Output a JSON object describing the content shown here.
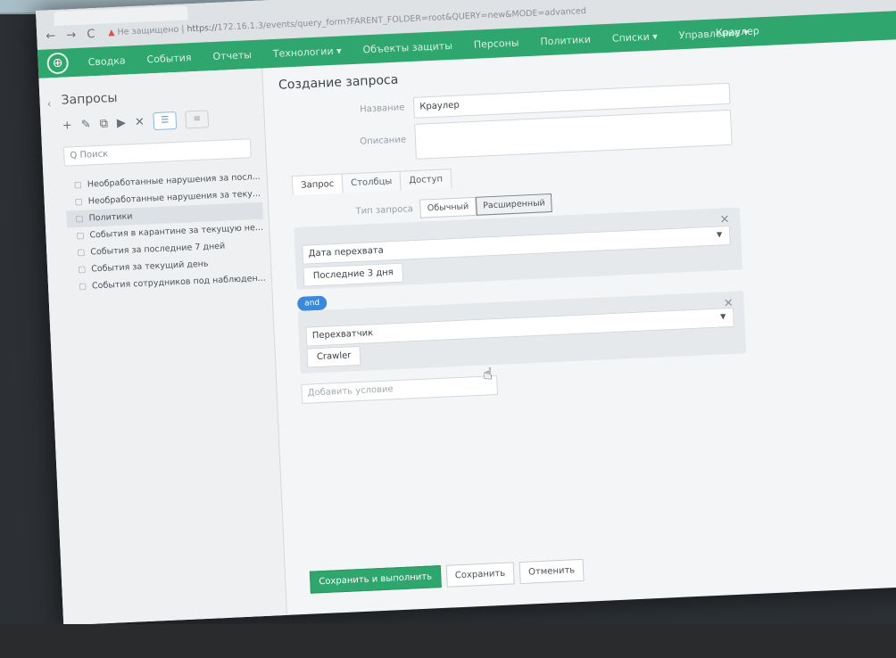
{
  "browser": {
    "tab_title": "",
    "back": "←",
    "forward": "→",
    "reload": "C",
    "warning_icon": "warning-icon",
    "security_label": "Не защищено",
    "url_proto": "https://",
    "url_rest": "172.16.1.3/events/query_form?FARENT_FOLDER=root&QUERY=new&MODE=advanced"
  },
  "appbar": {
    "nav": [
      "Сводка",
      "События",
      "Отчеты",
      "Технологии ▾",
      "Объекты защиты",
      "Персоны",
      "Политики",
      "Списки ▾",
      "Управление ▾"
    ],
    "user": "Краулер",
    "accent": "#2ea66d"
  },
  "sidebar": {
    "title": "Запросы",
    "collapse": "‹",
    "toolbar": [
      "+",
      "✎",
      "⧉",
      "▶",
      "✕"
    ],
    "search_placeholder": "Q Поиск",
    "items": [
      "Необработанные нарушения за посл...",
      "Необработанные нарушения за теку...",
      "Политики",
      "События в карантине за текущую не...",
      "События за последние 7 дней",
      "События за текущий день",
      "События сотрудников под наблюден..."
    ],
    "active_index": 2
  },
  "main": {
    "title": "Создание запроса",
    "name_label": "Название",
    "name_value": "Краулер",
    "desc_label": "Описание",
    "desc_value": "",
    "tabs": [
      "Запрос",
      "Столбцы",
      "Доступ"
    ],
    "type_label": "Тип запроса",
    "type_options": [
      "Обычный",
      "Расширенный"
    ],
    "conditions": [
      {
        "field": "Дата перехвата",
        "value": "Последние 3 дня"
      },
      {
        "field": "Перехватчик",
        "value": "Crawler"
      }
    ],
    "and_label": "and",
    "add_condition_placeholder": "Добавить условие",
    "buttons": {
      "save_run": "Сохранить и выполнить",
      "save": "Сохранить",
      "cancel": "Отменить"
    }
  }
}
